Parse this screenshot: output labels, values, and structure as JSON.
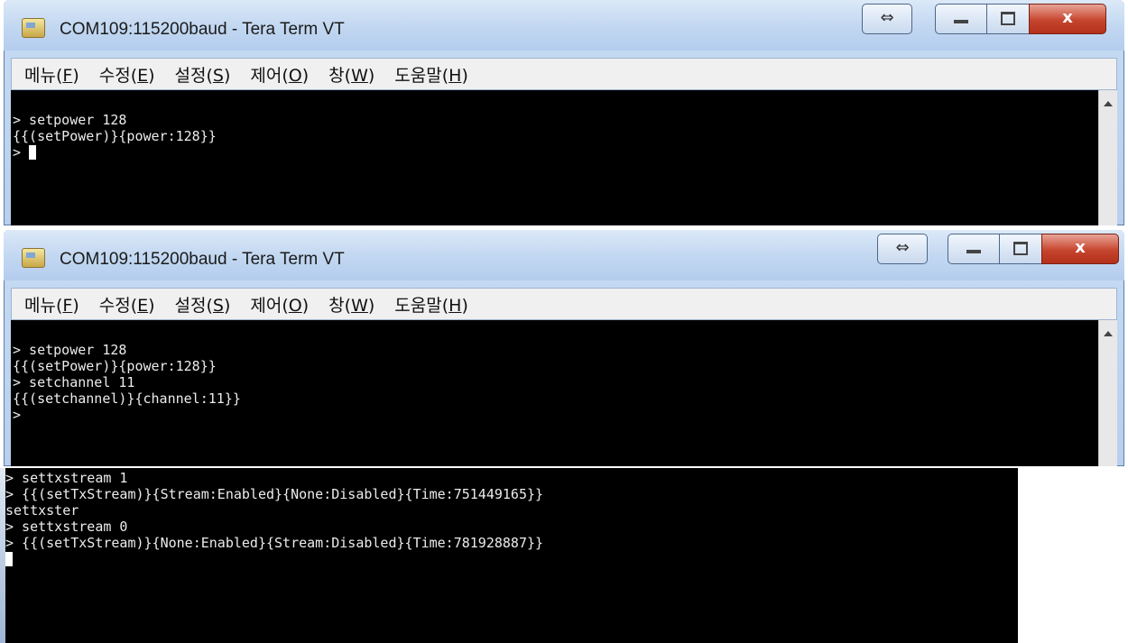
{
  "windows": [
    {
      "title": "COM109:115200baud - Tera Term VT",
      "controls": {
        "resize": "⇔",
        "minimize": "–",
        "maximize": "□",
        "close": "x"
      },
      "menu": [
        {
          "label": "메뉴(",
          "key": "F",
          "end": ")"
        },
        {
          "label": "수정(",
          "key": "E",
          "end": ")"
        },
        {
          "label": "설정(",
          "key": "S",
          "end": ")"
        },
        {
          "label": "제어(",
          "key": "O",
          "end": ")"
        },
        {
          "label": "창(",
          "key": "W",
          "end": ")"
        },
        {
          "label": "도움말(",
          "key": "H",
          "end": ")"
        }
      ],
      "terminal_lines": [
        "> setpower 128",
        "{{(setPower)}{power:128}}",
        "> "
      ]
    },
    {
      "title": "COM109:115200baud - Tera Term VT",
      "controls": {
        "resize": "⇔",
        "minimize": "–",
        "maximize": "□",
        "close": "x"
      },
      "menu": [
        {
          "label": "메뉴(",
          "key": "F",
          "end": ")"
        },
        {
          "label": "수정(",
          "key": "E",
          "end": ")"
        },
        {
          "label": "설정(",
          "key": "S",
          "end": ")"
        },
        {
          "label": "제어(",
          "key": "O",
          "end": ")"
        },
        {
          "label": "창(",
          "key": "W",
          "end": ")"
        },
        {
          "label": "도움말(",
          "key": "H",
          "end": ")"
        }
      ],
      "terminal_lines": [
        "> setpower 128",
        "{{(setPower)}{power:128}}",
        "> setchannel 11",
        "{{(setchannel)}{channel:11}}",
        ">"
      ]
    }
  ],
  "console3": {
    "terminal_lines": [
      "> settxstream 1",
      "> {{(setTxStream)}{Stream:Enabled}{None:Disabled}{Time:751449165}}",
      "settxster",
      "> settxstream 0",
      "> {{(setTxStream)}{None:Enabled}{Stream:Disabled}{Time:781928887}}",
      ""
    ]
  }
}
